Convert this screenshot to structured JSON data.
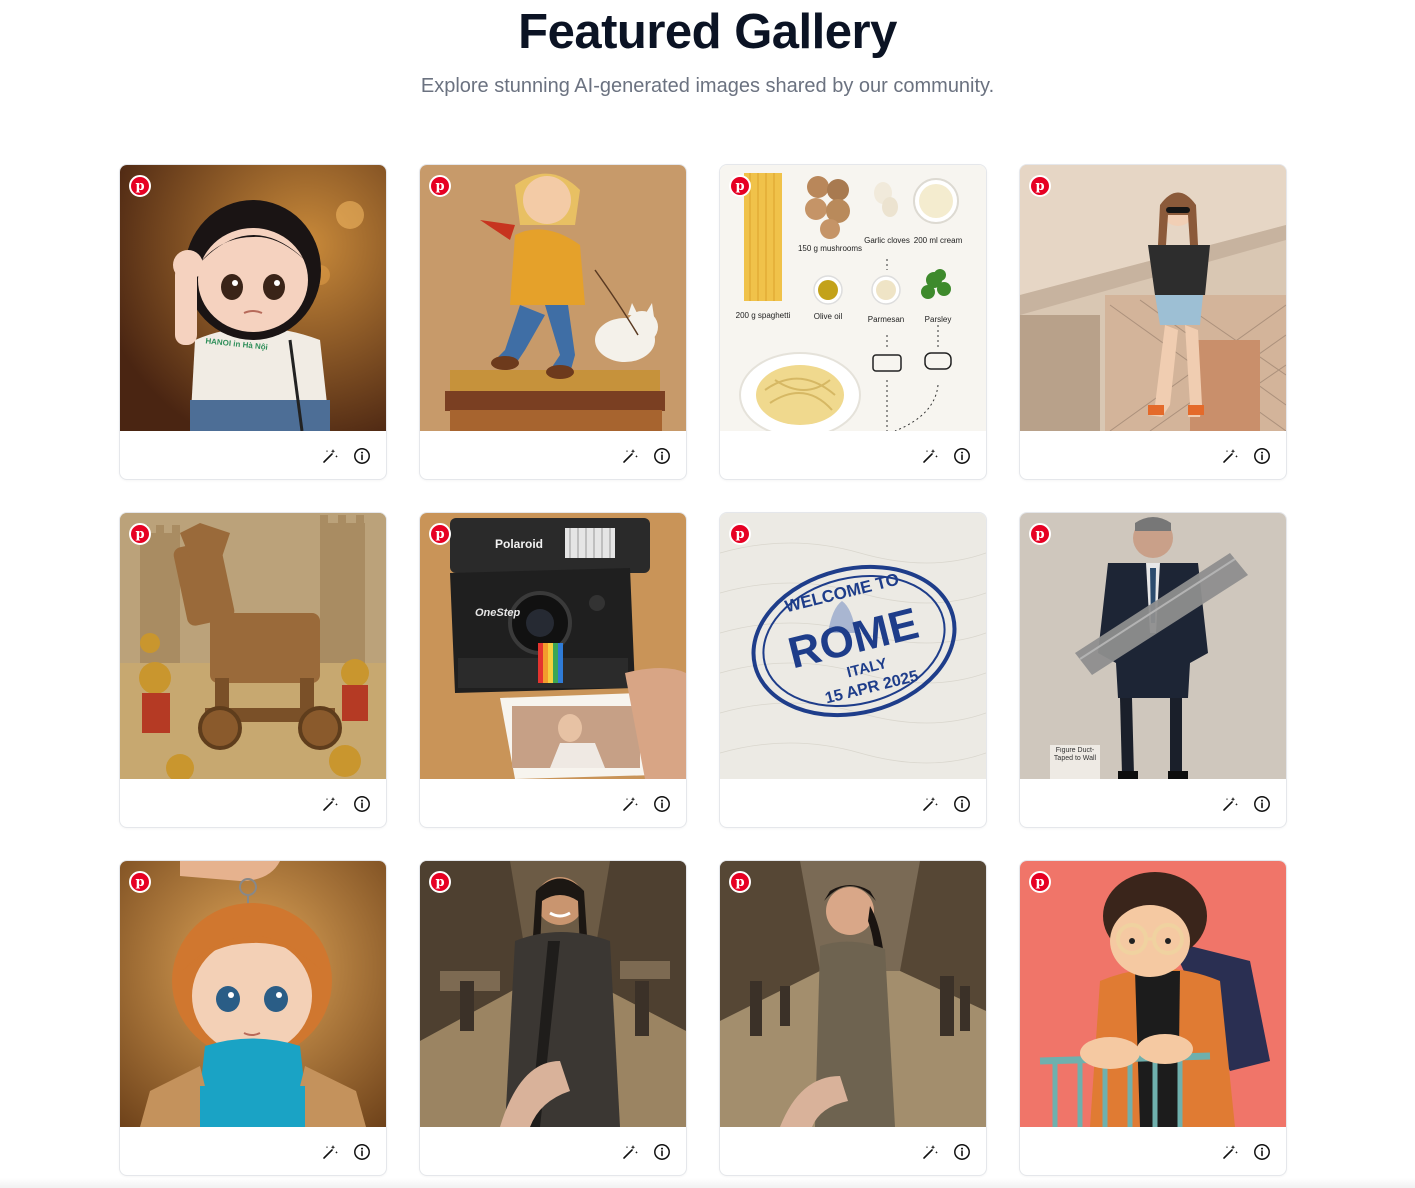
{
  "header": {
    "title": "Featured Gallery",
    "subtitle": "Explore stunning AI-generated images shared by our community."
  },
  "icons": {
    "badge": "pinterest-icon",
    "remix": "magic-wand-icon",
    "details": "info-icon"
  },
  "colors": {
    "pinterest_red": "#e60023",
    "title": "#0b1324",
    "subtitle": "#6b7280",
    "card_border": "#e5e7eb"
  },
  "cards": [
    {
      "image_text": {
        "shirt": "HANOI in Hà Nội"
      }
    },
    {
      "image_text": {}
    },
    {
      "image_text": {
        "spaghetti": "200 g spaghetti",
        "mushrooms": "150 g mushrooms",
        "garlic": "Garlic cloves",
        "cream": "200 ml cream",
        "oil": "Olive oil",
        "parmesan": "Parmesan",
        "parsley": "Parsley"
      }
    },
    {
      "image_text": {}
    },
    {
      "image_text": {}
    },
    {
      "image_text": {
        "brand": "Polaroid",
        "model": "OneStep"
      }
    },
    {
      "image_text": {
        "line1": "WELCOME TO",
        "line2": "ROME",
        "line3": "ITALY",
        "line4": "15 APR 2025"
      }
    },
    {
      "image_text": {
        "label": "Figure Duct-Taped to Wall"
      }
    },
    {
      "image_text": {}
    },
    {
      "image_text": {}
    },
    {
      "image_text": {}
    },
    {
      "image_text": {}
    }
  ]
}
